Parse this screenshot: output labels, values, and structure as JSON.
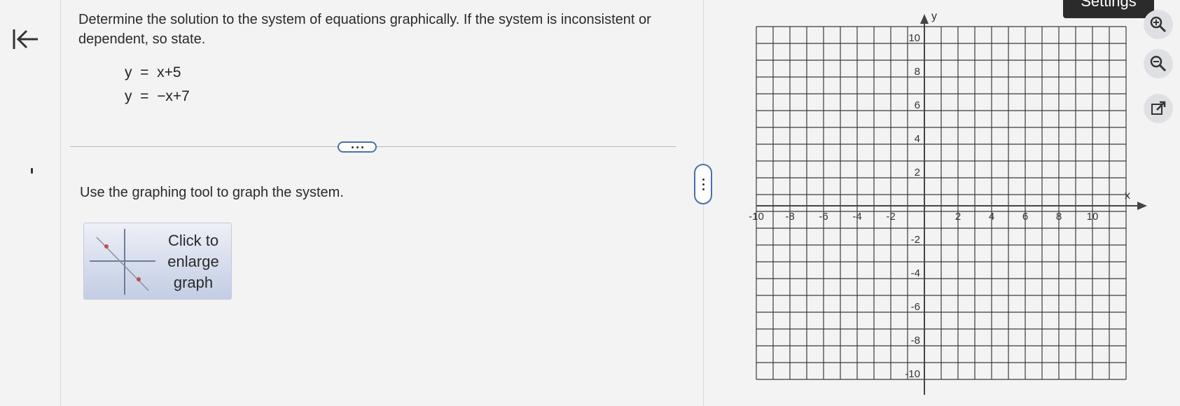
{
  "question": {
    "text": "Determine the solution to the system of equations graphically. If the system is inconsistent or dependent, so state.",
    "eq1": "y  =  x+5",
    "eq2": "y  =  −x+7"
  },
  "instruction": "Use the graphing tool to graph the system.",
  "enlarge_button": {
    "label": "Click to\nenlarge\ngraph"
  },
  "settings": {
    "label": "Settings"
  },
  "graph": {
    "x_label": "x",
    "y_label": "y",
    "x_ticks": [
      "-10",
      "-8",
      "-6",
      "-4",
      "-2",
      "2",
      "4",
      "6",
      "8",
      "10"
    ],
    "y_ticks": [
      "10",
      "8",
      "6",
      "4",
      "2",
      "-2",
      "-4",
      "-6",
      "-8",
      "-10"
    ]
  },
  "icons": {
    "back": "back-to-start-icon",
    "zoom_in": "zoom-in-icon",
    "zoom_out": "zoom-out-icon",
    "popout": "external-link-icon"
  },
  "colors": {
    "accent": "#4d6fa8",
    "grid": "#333333"
  }
}
